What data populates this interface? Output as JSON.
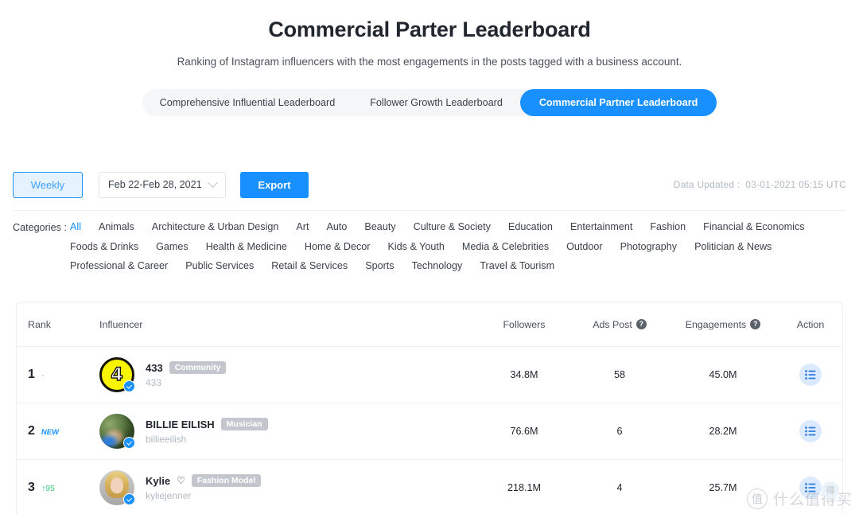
{
  "header": {
    "title": "Commercial Parter Leaderboard",
    "subtitle": "Ranking of Instagram influencers with the most engagements in the posts tagged with a business account."
  },
  "tabs": [
    {
      "label": "Comprehensive Influential Leaderboard",
      "active": false
    },
    {
      "label": "Follower Growth Leaderboard",
      "active": false
    },
    {
      "label": "Commercial Partner Leaderboard",
      "active": true
    }
  ],
  "toolbar": {
    "weekly_label": "Weekly",
    "date_range": "Feb 22-Feb 28, 2021",
    "date_chevron_icon": "chevron-down-icon",
    "export_label": "Export",
    "data_updated_label": "Data Updated :",
    "data_updated_value": "03-01-2021 05:15 UTC"
  },
  "categories": {
    "label": "Categories :",
    "rows": [
      [
        {
          "label": "All",
          "active": true
        },
        {
          "label": "Animals",
          "active": false
        },
        {
          "label": "Architecture & Urban Design",
          "active": false
        },
        {
          "label": "Art",
          "active": false
        },
        {
          "label": "Auto",
          "active": false
        },
        {
          "label": "Beauty",
          "active": false
        },
        {
          "label": "Culture & Society",
          "active": false
        },
        {
          "label": "Education",
          "active": false
        },
        {
          "label": "Entertainment",
          "active": false
        },
        {
          "label": "Fashion",
          "active": false
        },
        {
          "label": "Financial & Economics",
          "active": false
        }
      ],
      [
        {
          "label": "Foods & Drinks",
          "active": false
        },
        {
          "label": "Games",
          "active": false
        },
        {
          "label": "Health & Medicine",
          "active": false
        },
        {
          "label": "Home & Decor",
          "active": false
        },
        {
          "label": "Kids & Youth",
          "active": false
        },
        {
          "label": "Media & Celebrities",
          "active": false
        },
        {
          "label": "Outdoor",
          "active": false
        },
        {
          "label": "Photography",
          "active": false
        },
        {
          "label": "Politician & News",
          "active": false
        }
      ],
      [
        {
          "label": "Professional & Career",
          "active": false
        },
        {
          "label": "Public Services",
          "active": false
        },
        {
          "label": "Retail & Services",
          "active": false
        },
        {
          "label": "Sports",
          "active": false
        },
        {
          "label": "Technology",
          "active": false
        },
        {
          "label": "Travel & Tourism",
          "active": false
        }
      ]
    ]
  },
  "table": {
    "columns": {
      "rank": "Rank",
      "influencer": "Influencer",
      "followers": "Followers",
      "ads_post": "Ads Post",
      "engagements": "Engagements",
      "action": "Action",
      "help_icon": "?"
    },
    "rows": [
      {
        "rank": "1",
        "delta": "-",
        "delta_type": "same",
        "avatar_icon": "avatar-433",
        "verified": true,
        "name": "433",
        "heart": "",
        "tag": "Community",
        "handle": "433",
        "followers": "34.8M",
        "ads_post": "58",
        "engagements": "45.0M",
        "action_icon": "list-icon"
      },
      {
        "rank": "2",
        "delta": "NEW",
        "delta_type": "new",
        "avatar_icon": "avatar-billieeilish",
        "verified": true,
        "name": "BILLIE EILISH",
        "heart": "",
        "tag": "Musician",
        "handle": "billieeilish",
        "followers": "76.6M",
        "ads_post": "6",
        "engagements": "28.2M",
        "action_icon": "list-icon"
      },
      {
        "rank": "3",
        "delta": "↑95",
        "delta_type": "up",
        "avatar_icon": "avatar-kyliejenner",
        "verified": true,
        "name": "Kylie",
        "heart": "♡",
        "tag": "Fashion Model",
        "handle": "kyliejenner",
        "followers": "218.1M",
        "ads_post": "4",
        "engagements": "25.7M",
        "action_icon": "list-icon"
      }
    ]
  },
  "watermark": {
    "logo_glyph": "值",
    "text": "什么值得买",
    "badge_glyph": "得"
  },
  "colors": {
    "accent": "#1890ff",
    "accent_soft": "#e5f2ff",
    "up": "#3cc47c",
    "muted": "#b3b9c3",
    "tag_bg": "#c3c7cd"
  }
}
